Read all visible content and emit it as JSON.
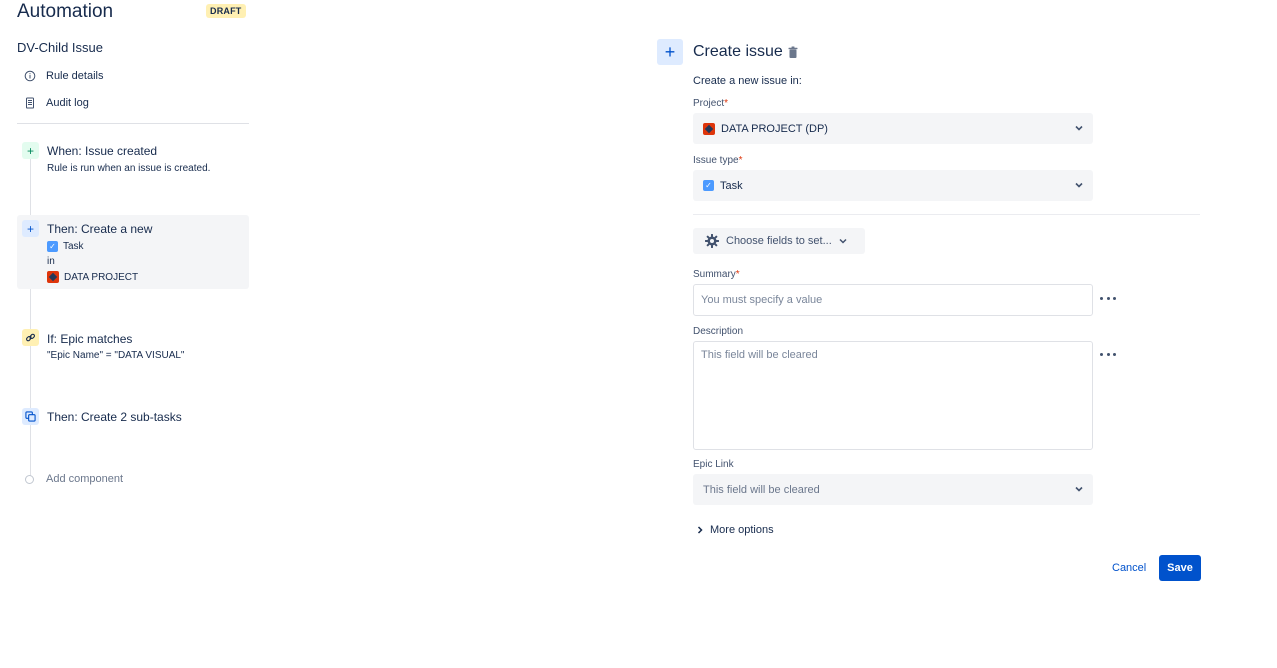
{
  "app": {
    "title": "Automation",
    "badge": "DRAFT"
  },
  "rule": {
    "name": "DV-Child Issue"
  },
  "sidebar": {
    "links": [
      {
        "label": "Rule details",
        "icon": "info-icon"
      },
      {
        "label": "Audit log",
        "icon": "document-icon"
      }
    ]
  },
  "components": [
    {
      "title": "When: Issue created",
      "desc": "Rule is run when an issue is created.",
      "icon": "plus-icon",
      "icon_color": "#00875a",
      "icon_bg": "#e3fcef"
    },
    {
      "title": "Then: Create a new",
      "line1": "Task",
      "line2": "in",
      "line3": "DATA PROJECT",
      "icon": "plus-icon",
      "icon_color": "#0052cc",
      "icon_bg": "#deebff"
    },
    {
      "title": "If: Epic matches",
      "desc": "\"Epic Name\" = \"DATA VISUAL\"",
      "icon": "link-icon",
      "icon_color": "#ff991f",
      "icon_bg": "#fff0b3"
    },
    {
      "title": "Then: Create 2 sub-tasks",
      "icon": "subtask-icon",
      "icon_color": "#0052cc",
      "icon_bg": "#deebff"
    }
  ],
  "add_component": "Add component",
  "panel": {
    "title": "Create issue",
    "subtitle": "Create a new issue in:",
    "project_label": "Project",
    "project_value": "DATA PROJECT (DP)",
    "issue_type_label": "Issue type",
    "issue_type_value": "Task",
    "choose_fields": "Choose fields to set...",
    "summary_label": "Summary",
    "summary_placeholder": "You must specify a value",
    "description_label": "Description",
    "description_placeholder": "This field will be cleared",
    "epic_link_label": "Epic Link",
    "epic_link_placeholder": "This field will be cleared",
    "more_options": "More options",
    "cancel": "Cancel",
    "save": "Save",
    "required_mark": "*"
  },
  "colors": {
    "accent": "#0052cc",
    "required": "#de350b"
  }
}
